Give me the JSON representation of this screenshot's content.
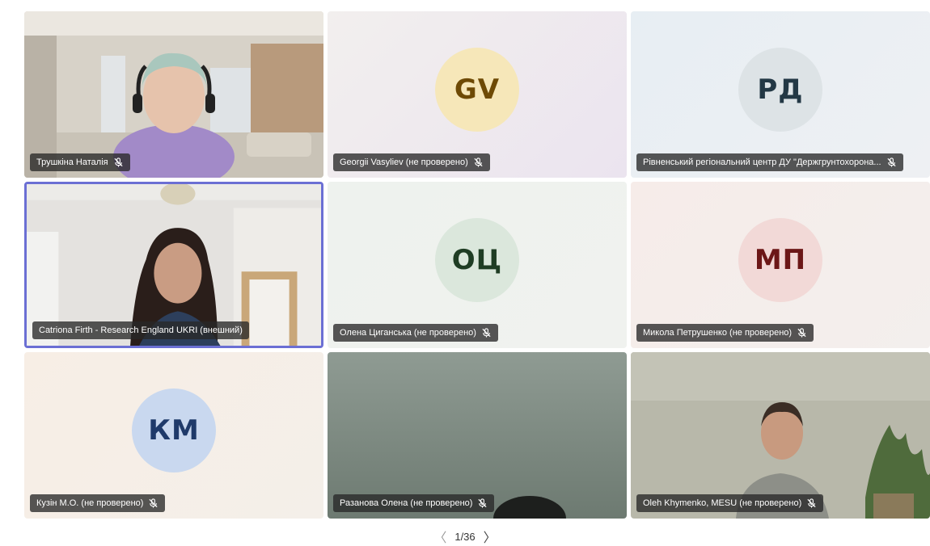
{
  "tiles": [
    {
      "name": "Трушкіна Наталія",
      "type": "video",
      "muted": true
    },
    {
      "name": "Georgii Vasyliev (не проверено)",
      "initials": "GV",
      "type": "avatar",
      "avatar_bg": "#f6e7b9",
      "avatar_fg": "#6e4a05",
      "muted": true
    },
    {
      "name": "Рівненський регіональний центр ДУ \"Держгрунтохорона...",
      "initials": "РД",
      "type": "avatar",
      "avatar_bg": "#dde3e6",
      "avatar_fg": "#233845",
      "muted": true
    },
    {
      "name": "Catriona Firth - Research England UKRI (внешний)",
      "type": "video",
      "active": true,
      "muted": false
    },
    {
      "name": "Олена Циганська (не проверено)",
      "initials": "ОЦ",
      "type": "avatar",
      "avatar_bg": "#dbe7dc",
      "avatar_fg": "#1f3d24",
      "muted": true
    },
    {
      "name": "Микола Петрушенко (не проверено)",
      "initials": "МП",
      "type": "avatar",
      "avatar_bg": "#f2d9d7",
      "avatar_fg": "#6c1717",
      "muted": true
    },
    {
      "name": "Кузін М.О. (не проверено)",
      "initials": "КМ",
      "type": "avatar",
      "avatar_bg": "#c9d8ef",
      "avatar_fg": "#1f3a6a",
      "muted": true
    },
    {
      "name": "Разанова Олена (не проверено)",
      "type": "video",
      "muted": true
    },
    {
      "name": "Oleh Khymenko, MESU (не проверено)",
      "type": "video",
      "muted": true
    }
  ],
  "pagination": {
    "label": "1/36",
    "prev_icon": "chevron-left-icon",
    "next_icon": "chevron-right-icon"
  },
  "colors": {
    "active_border": "#6b6fd4",
    "namebar_bg": "#282828"
  }
}
